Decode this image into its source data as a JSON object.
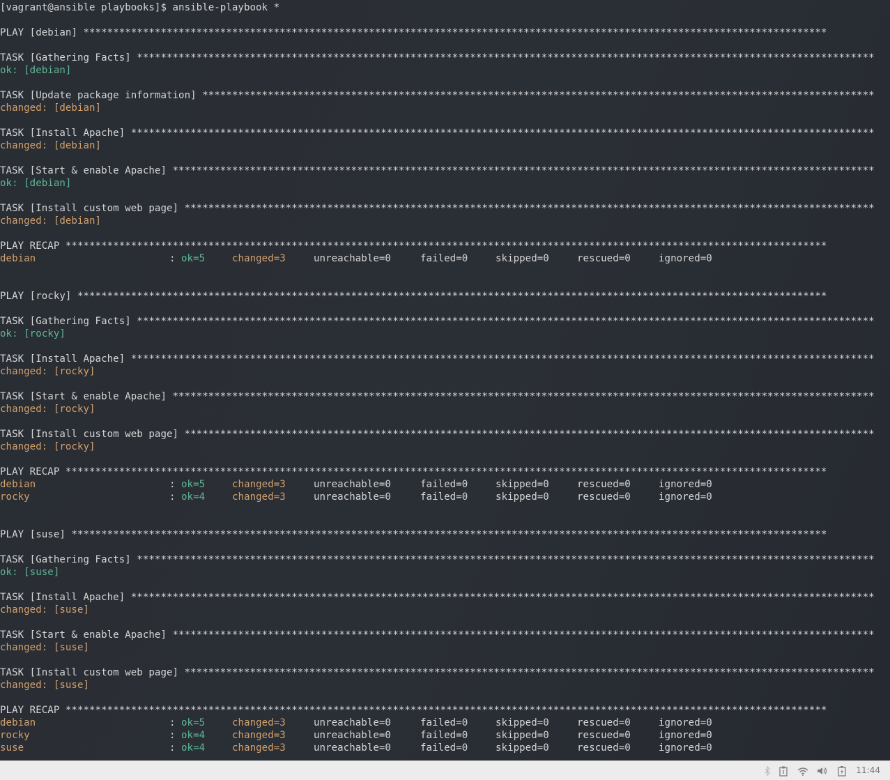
{
  "terminal": {
    "lines": [
      {
        "type": "cmd",
        "text": "[vagrant@ansible playbooks]$ ansible-playbook *"
      },
      {
        "type": "blank"
      },
      {
        "type": "header",
        "text": "PLAY [debian] *****************************************************************************************************************************"
      },
      {
        "type": "blank"
      },
      {
        "type": "header",
        "text": "TASK [Gathering Facts] ****************************************************************************************************************************"
      },
      {
        "type": "status",
        "kind": "ok",
        "text": "ok: [debian]"
      },
      {
        "type": "blank"
      },
      {
        "type": "header",
        "text": "TASK [Update package information] *****************************************************************************************************************"
      },
      {
        "type": "status",
        "kind": "changed",
        "text": "changed: [debian]"
      },
      {
        "type": "blank"
      },
      {
        "type": "header",
        "text": "TASK [Install Apache] *****************************************************************************************************************************"
      },
      {
        "type": "status",
        "kind": "changed",
        "text": "changed: [debian]"
      },
      {
        "type": "blank"
      },
      {
        "type": "header",
        "text": "TASK [Start & enable Apache] **********************************************************************************************************************"
      },
      {
        "type": "status",
        "kind": "ok",
        "text": "ok: [debian]"
      },
      {
        "type": "blank"
      },
      {
        "type": "header",
        "text": "TASK [Install custom web page] ********************************************************************************************************************"
      },
      {
        "type": "status",
        "kind": "changed",
        "text": "changed: [debian]"
      },
      {
        "type": "blank"
      },
      {
        "type": "header",
        "text": "PLAY RECAP ********************************************************************************************************************************"
      },
      {
        "type": "recap",
        "host": "debian",
        "host_kind": "changed",
        "ok": "ok=5",
        "changed": "changed=3",
        "unreachable": "unreachable=0",
        "failed": "failed=0",
        "skipped": "skipped=0",
        "rescued": "rescued=0",
        "ignored": "ignored=0"
      },
      {
        "type": "blank"
      },
      {
        "type": "blank"
      },
      {
        "type": "header",
        "text": "PLAY [rocky] ******************************************************************************************************************************"
      },
      {
        "type": "blank"
      },
      {
        "type": "header",
        "text": "TASK [Gathering Facts] ****************************************************************************************************************************"
      },
      {
        "type": "status",
        "kind": "ok",
        "text": "ok: [rocky]"
      },
      {
        "type": "blank"
      },
      {
        "type": "header",
        "text": "TASK [Install Apache] *****************************************************************************************************************************"
      },
      {
        "type": "status",
        "kind": "changed",
        "text": "changed: [rocky]"
      },
      {
        "type": "blank"
      },
      {
        "type": "header",
        "text": "TASK [Start & enable Apache] **********************************************************************************************************************"
      },
      {
        "type": "status",
        "kind": "changed",
        "text": "changed: [rocky]"
      },
      {
        "type": "blank"
      },
      {
        "type": "header",
        "text": "TASK [Install custom web page] ********************************************************************************************************************"
      },
      {
        "type": "status",
        "kind": "changed",
        "text": "changed: [rocky]"
      },
      {
        "type": "blank"
      },
      {
        "type": "header",
        "text": "PLAY RECAP ********************************************************************************************************************************"
      },
      {
        "type": "recap",
        "host": "debian",
        "host_kind": "changed",
        "ok": "ok=5",
        "changed": "changed=3",
        "unreachable": "unreachable=0",
        "failed": "failed=0",
        "skipped": "skipped=0",
        "rescued": "rescued=0",
        "ignored": "ignored=0"
      },
      {
        "type": "recap",
        "host": "rocky",
        "host_kind": "changed",
        "ok": "ok=4",
        "changed": "changed=3",
        "unreachable": "unreachable=0",
        "failed": "failed=0",
        "skipped": "skipped=0",
        "rescued": "rescued=0",
        "ignored": "ignored=0"
      },
      {
        "type": "blank"
      },
      {
        "type": "blank"
      },
      {
        "type": "header",
        "text": "PLAY [suse] *******************************************************************************************************************************"
      },
      {
        "type": "blank"
      },
      {
        "type": "header",
        "text": "TASK [Gathering Facts] ****************************************************************************************************************************"
      },
      {
        "type": "status",
        "kind": "ok",
        "text": "ok: [suse]"
      },
      {
        "type": "blank"
      },
      {
        "type": "header",
        "text": "TASK [Install Apache] *****************************************************************************************************************************"
      },
      {
        "type": "status",
        "kind": "changed",
        "text": "changed: [suse]"
      },
      {
        "type": "blank"
      },
      {
        "type": "header",
        "text": "TASK [Start & enable Apache] **********************************************************************************************************************"
      },
      {
        "type": "status",
        "kind": "changed",
        "text": "changed: [suse]"
      },
      {
        "type": "blank"
      },
      {
        "type": "header",
        "text": "TASK [Install custom web page] ********************************************************************************************************************"
      },
      {
        "type": "status",
        "kind": "changed",
        "text": "changed: [suse]"
      },
      {
        "type": "blank"
      },
      {
        "type": "header",
        "text": "PLAY RECAP ********************************************************************************************************************************"
      },
      {
        "type": "recap",
        "host": "debian",
        "host_kind": "changed",
        "ok": "ok=5",
        "changed": "changed=3",
        "unreachable": "unreachable=0",
        "failed": "failed=0",
        "skipped": "skipped=0",
        "rescued": "rescued=0",
        "ignored": "ignored=0"
      },
      {
        "type": "recap",
        "host": "rocky",
        "host_kind": "changed",
        "ok": "ok=4",
        "changed": "changed=3",
        "unreachable": "unreachable=0",
        "failed": "failed=0",
        "skipped": "skipped=0",
        "rescued": "rescued=0",
        "ignored": "ignored=0"
      },
      {
        "type": "recap",
        "host": "suse",
        "host_kind": "changed",
        "ok": "ok=4",
        "changed": "changed=3",
        "unreachable": "unreachable=0",
        "failed": "failed=0",
        "skipped": "skipped=0",
        "rescued": "rescued=0",
        "ignored": "ignored=0"
      }
    ]
  },
  "colors": {
    "background": "#2a2e35",
    "text": "#d6d6d6",
    "ok": "#5fb896",
    "changed": "#d2a06d",
    "taskbar": "#ececec"
  },
  "taskbar": {
    "tray_icons": [
      "bluetooth-icon",
      "clipboard-icon",
      "wifi-icon",
      "volume-icon",
      "battery-icon"
    ],
    "clock": "11:44"
  }
}
